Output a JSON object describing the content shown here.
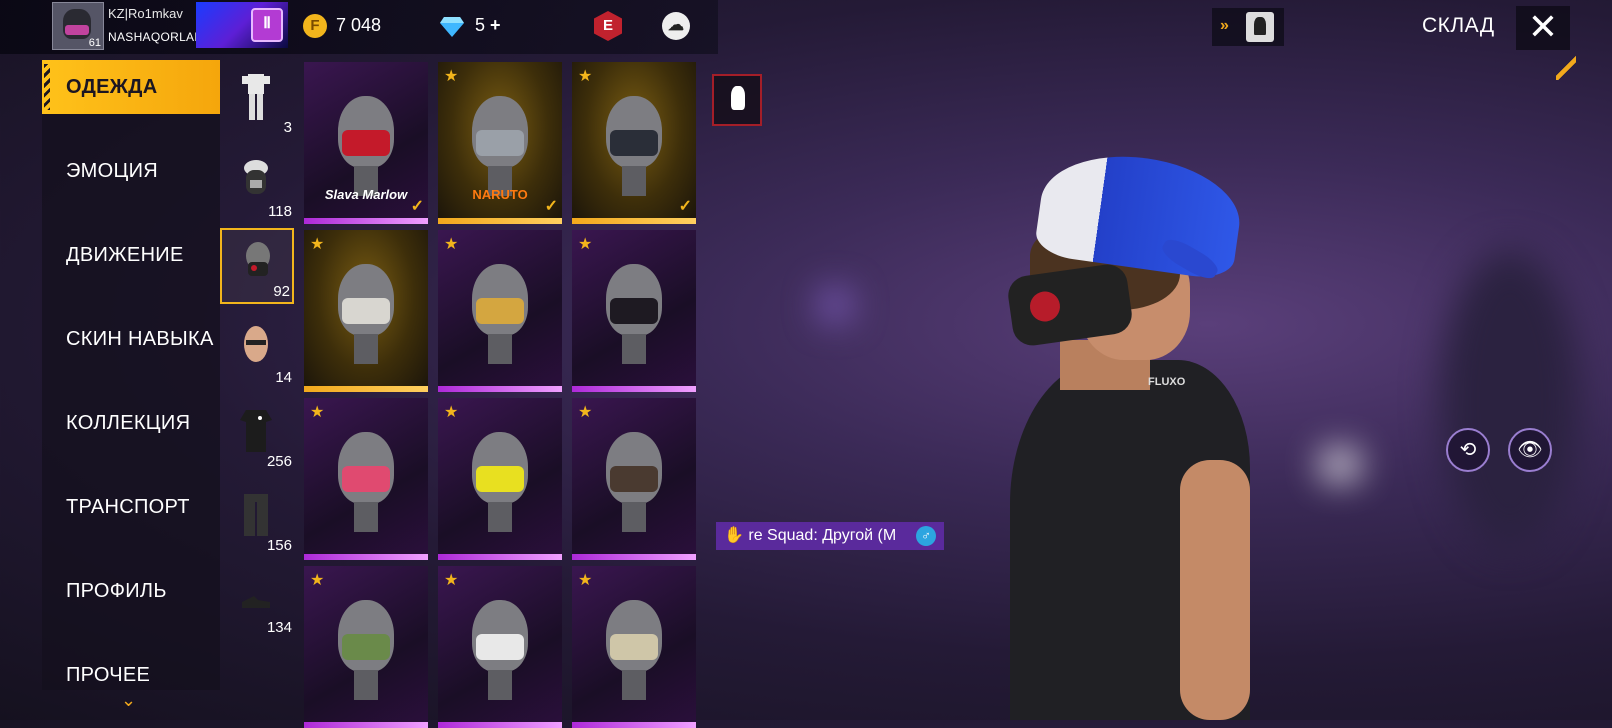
{
  "header": {
    "player_name": "KZ|Ro1mkav",
    "guild_name": "NASHAQORLAR",
    "level": "61",
    "gold_icon_letter": "F",
    "gold_amount": "7 048",
    "diamonds": "5",
    "diamonds_plus": "+",
    "elite_badge": "E",
    "title": "СКЛАД",
    "close_symbol": "✕",
    "arrows": "»"
  },
  "menu": {
    "items": [
      {
        "label": "ОДЕЖДА",
        "active": true
      },
      {
        "label": "ЭМОЦИЯ"
      },
      {
        "label": "ДВИЖЕНИЕ"
      },
      {
        "label": "СКИН НАВЫКА"
      },
      {
        "label": "КОЛЛЕКЦИЯ"
      },
      {
        "label": "ТРАНСПОРТ"
      },
      {
        "label": "ПРОФИЛЬ"
      },
      {
        "label": "ПРОЧЕЕ"
      }
    ],
    "more_icon": "chevron-down-icon"
  },
  "subcategories": [
    {
      "icon": "full-outfit-icon",
      "count": "3"
    },
    {
      "icon": "head-icon",
      "count": "118"
    },
    {
      "icon": "mask-icon",
      "count": "92",
      "active": true
    },
    {
      "icon": "face-paint-icon",
      "count": "14"
    },
    {
      "icon": "top-icon",
      "count": "256"
    },
    {
      "icon": "bottom-icon",
      "count": "156"
    },
    {
      "icon": "shoes-icon",
      "count": "134"
    }
  ],
  "items": [
    {
      "rarity": "purple",
      "star": false,
      "equipped": true,
      "logo": "Slava Marlow",
      "mask_color": "#c41a2a"
    },
    {
      "rarity": "gold",
      "star": true,
      "equipped": true,
      "logo": "NARUTO",
      "mask_color": "#9aa0a8"
    },
    {
      "rarity": "gold",
      "star": true,
      "equipped": true,
      "logo": "",
      "mask_color": "#2a2e38"
    },
    {
      "rarity": "gold",
      "star": true,
      "equipped": false,
      "logo": "",
      "mask_color": "#d8d6d0"
    },
    {
      "rarity": "purple",
      "star": true,
      "equipped": false,
      "logo": "",
      "mask_color": "#d4a640"
    },
    {
      "rarity": "purple",
      "star": true,
      "equipped": false,
      "logo": "",
      "mask_color": "#1e1a22"
    },
    {
      "rarity": "purple",
      "star": true,
      "equipped": false,
      "logo": "",
      "mask_color": "#e04a70"
    },
    {
      "rarity": "purple",
      "star": true,
      "equipped": false,
      "logo": "",
      "mask_color": "#e8e020"
    },
    {
      "rarity": "purple",
      "star": true,
      "equipped": false,
      "logo": "",
      "mask_color": "#4a3a30"
    },
    {
      "rarity": "purple",
      "star": true,
      "equipped": false,
      "logo": "",
      "mask_color": "#6a8a4a"
    },
    {
      "rarity": "purple",
      "star": true,
      "equipped": false,
      "logo": "",
      "mask_color": "#e8e8e8"
    },
    {
      "rarity": "purple",
      "star": true,
      "equipped": false,
      "logo": "",
      "mask_color": "#cfc6a8"
    }
  ],
  "item_tag": {
    "text": "re Squad: Другой (M",
    "gender_symbol": "♂"
  },
  "side_buttons": {
    "rotate_icon": "rotate-icon",
    "view_icon": "view-character-icon"
  },
  "character": {
    "shirt_logo": "FLUXO"
  },
  "colors": {
    "accent": "#f2b51c",
    "purple_rarity": "#ad29d8",
    "tag_bg": "#5a2a9c"
  }
}
